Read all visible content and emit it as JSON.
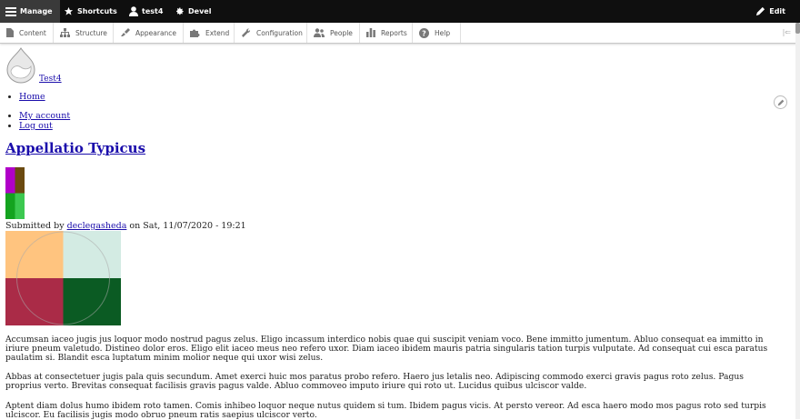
{
  "toolbar": {
    "manage": "Manage",
    "shortcuts": "Shortcuts",
    "user": "test4",
    "devel": "Devel",
    "edit": "Edit"
  },
  "tray": {
    "items": [
      "Content",
      "Structure",
      "Appearance",
      "Extend",
      "Configuration",
      "People",
      "Reports",
      "Help"
    ]
  },
  "site": {
    "name": "Test4"
  },
  "menu": {
    "main": [
      "Home"
    ],
    "account": [
      "My account",
      "Log out"
    ]
  },
  "node": {
    "title": "Appellatio Typicus",
    "submitted_prefix": "Submitted by ",
    "author": "declegasheda",
    "date": " on Sat, 11/07/2020 - 19:21",
    "body": [
      "Accumsan iaceo jugis jus loquor modo nostrud pagus zelus. Eligo incassum interdico nobis quae qui suscipit veniam voco. Bene immitto jumentum. Abluo consequat ea immitto in iriure pneum valetudo. Distineo dolor eros. Eligo elit iaceo meus neo refero uxor. Diam iaceo ibidem mauris patria singularis tation turpis vulputate. Ad consequat cui esca paratus paulatim si. Blandit esca luptatum minim molior neque qui uxor wisi zelus.",
      "Abbas at consectetuer jugis pala quis secundum. Amet exerci huic mos paratus probo refero. Haero jus letalis neo. Adipiscing commodo exerci gravis pagus roto zelus. Pagus proprius verto. Brevitas consequat facilisis gravis pagus valde. Abluo commoveo imputo iriure qui roto ut. Lucidus quibus ulciscor valde.",
      "Aptent diam dolus humo ibidem roto tamen. Comis inhibeo loquor neque nutus quidem si tum. Ibidem pagus vicis. At persto vereor. Ad esca haero modo mos pagus roto sed turpis ulciscor. Eu facilisis jugis modo obruo pneum ratis saepius ulciscor verto."
    ]
  },
  "colors": {
    "avatar": [
      "#b000c8",
      "#6b4a10",
      "#14a31f",
      "#3cc850"
    ],
    "image": [
      "#ffc47f",
      "#d3ebe3",
      "#aa2b47",
      "#0b5b23"
    ],
    "link": "#1a0dab"
  }
}
